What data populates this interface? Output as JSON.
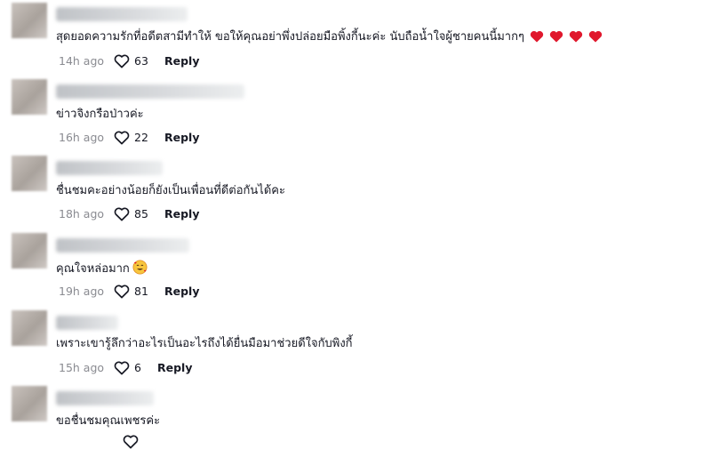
{
  "comments": [
    {
      "text": "สุดยอดความรักที่อดีตสามีทำให้ ขอให้คุณอย่าพึ่งปล่อยมือพิ้งกี้นะค่ะ นับถือน้ำใจผู้ชายคนนี้มากๆ",
      "emoji": "heart-red x4",
      "time": "14h ago",
      "likes": "63",
      "reply": "Reply"
    },
    {
      "text": "ข่าวจิงกรือป่าวค่ะ",
      "time": "16h ago",
      "likes": "22",
      "reply": "Reply"
    },
    {
      "text": "ชื่นชมคะอย่างน้อยก็ยังเป็นเพื่อนที่ดีต่อกันได้คะ",
      "time": "18h ago",
      "likes": "85",
      "reply": "Reply"
    },
    {
      "text": "คุณใจหล่อมาก",
      "emoji": "smiling-face-with-hearts",
      "time": "19h ago",
      "likes": "81",
      "reply": "Reply"
    },
    {
      "text": "เพราะเขารู้ลึกว่าอะไรเป็นอะไรถึงได้ยื่นมือมาช่วยดีใจกับพิงกี้",
      "time": "15h ago",
      "likes": "6",
      "reply": "Reply"
    },
    {
      "text": "ขอชื่นชมคุณเพชรค่ะ"
    }
  ],
  "colors": {
    "text": "#161823",
    "meta": "#8a8b91",
    "heart": "#e0182d"
  }
}
